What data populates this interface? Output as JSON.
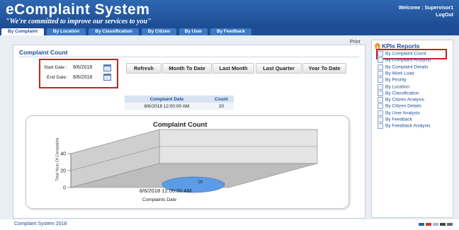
{
  "header": {
    "title": "eComplaint System",
    "tagline": "\"We're committed to improve our services to you\"",
    "welcome": "Welcome : Supervisor1",
    "logout": "LogOut"
  },
  "tabs": [
    "By Complaint",
    "By Location",
    "By Classification",
    "By Citizen",
    "By User",
    "By Feedback"
  ],
  "main": {
    "print_label": "Print",
    "section_title": "Complaint Count",
    "start_date_label": "Start Date :",
    "start_date": "8/6/2018",
    "end_date_label": "End Date :",
    "end_date": "8/6/2018",
    "buttons": [
      "Refresh",
      "Month To Date",
      "Last Month",
      "Last Quarter",
      "Year To Date"
    ],
    "table": {
      "headers": [
        "Complaint Date",
        "Count"
      ],
      "rows": [
        [
          "8/6/2018 12:00:00 AM",
          "20"
        ]
      ]
    }
  },
  "chart_data": {
    "type": "bar",
    "title": "Complaint Count",
    "categories": [
      "8/6/2018 12:00:00 AM"
    ],
    "values": [
      20
    ],
    "data_labels": [
      "20"
    ],
    "xlabel": "Complaints Date",
    "ylabel": "Total Num Of Complaints",
    "ylim": [
      0,
      40
    ],
    "yticks": [
      "0",
      "20",
      "40"
    ],
    "grid": true,
    "style": "3d-cylinder"
  },
  "sidebar": {
    "title": "KPIs Reports",
    "items": [
      "By Complaint Count",
      "By Complaint Analysis",
      "By Complaint Details",
      "By Work Load",
      "By Priority",
      "By Location",
      "By Classification",
      "By Citizen Analysis",
      "By Citizen Details",
      "By User Analysis",
      "By Feedback",
      "By Feedback Analysis"
    ]
  },
  "footer": {
    "text": "Complaint System  2018"
  },
  "colors": {
    "brand": "#1d4d93",
    "highlight": "#cc1f1f",
    "bar": "#3b82d8"
  }
}
